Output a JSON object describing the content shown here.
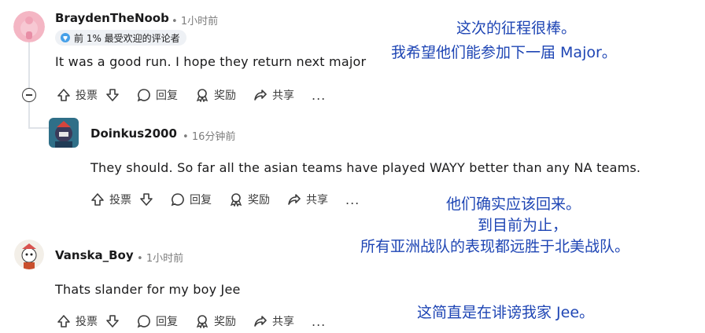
{
  "comments": [
    {
      "username": "BraydenTheNoob",
      "time": "1小时前",
      "badge": "前 1% 最受欢迎的评论者",
      "text": "It was a good run. I hope they return next major",
      "actions": {
        "upvote": "投票",
        "reply": "回复",
        "award": "奖励",
        "share": "共享",
        "more": "..."
      }
    },
    {
      "username": "Doinkus2000",
      "time": "16分钟前",
      "text": "They should. So far all the asian teams have played WAYY better than any NA teams.",
      "actions": {
        "upvote": "投票",
        "reply": "回复",
        "award": "奖励",
        "share": "共享",
        "more": "..."
      }
    },
    {
      "username": "Vanska_Boy",
      "time": "1小时前",
      "text": "Thats slander for my boy Jee",
      "actions": {
        "upvote": "投票",
        "reply": "回复",
        "award": "奖励",
        "share": "共享",
        "more": "..."
      }
    }
  ],
  "translations": {
    "t1_line1": "这次的征程很棒。",
    "t1_line2": "我希望他们能参加下一届 Major。",
    "t2_line1": "他们确实应该回来。",
    "t2_line2": "到目前为止，",
    "t2_line3": "所有亚洲战队的表现都远胜于北美战队。",
    "t3_line1": "这简直是在诽谤我家 Jee。"
  },
  "colors": {
    "translation": "#1e45b4",
    "badge_bg": "#eef1f5",
    "thread_line": "#dfe3e8"
  },
  "dot": "•"
}
